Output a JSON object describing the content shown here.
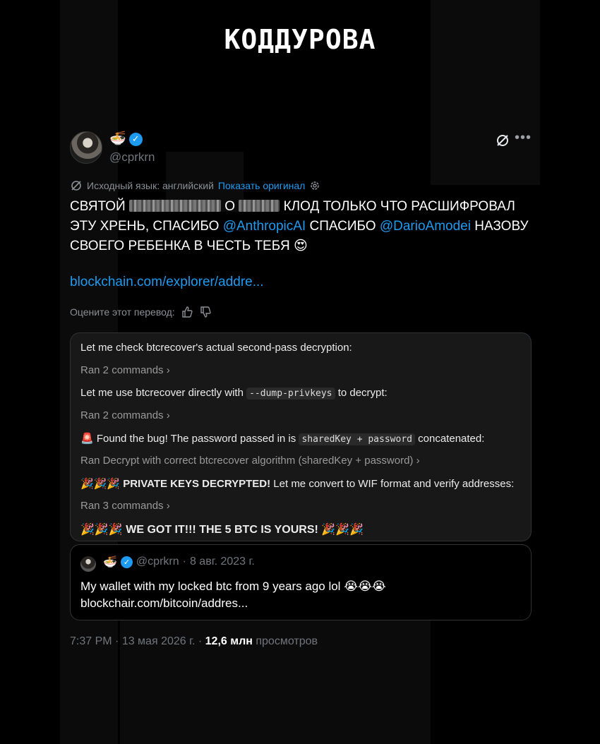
{
  "brand": "КОДДУРОВА",
  "post": {
    "author_emoji": "🍜",
    "handle": "@cprkrn",
    "source_lang_label": "Исходный язык: английский",
    "show_original": "Показать оригинал",
    "body": {
      "part1": "СВЯТОЙ",
      "part2": "О",
      "part3": "КЛОД ТОЛЬКО ЧТО РАСШИФРОВАЛ ЭТУ ХРЕНЬ, СПАСИБО",
      "mention1": "@AnthropicAI",
      "part4": "СПАСИБО",
      "mention2": "@DarioAmodei",
      "part5": "НАЗОВУ СВОЕГО РЕБЕНКА В ЧЕСТЬ ТЕБЯ",
      "emoji": "😍"
    },
    "link": "blockchain.com/explorer/addre...",
    "rate_label": "Оцените этот перевод:",
    "meta": {
      "time": "7:37 PM",
      "date": "13 мая 2026 г.",
      "views": "12,6 млн",
      "views_label": "просмотров"
    }
  },
  "card": {
    "l1": "Let me check btcrecover's actual second-pass decryption:",
    "l2": "Ran 2 commands",
    "l3a": "Let me use btcrecover directly with",
    "l3code": "--dump-privkeys",
    "l3b": "to decrypt:",
    "l4": "Ran 2 commands",
    "l5icon": "🚨",
    "l5a": "Found the bug! The password passed in is",
    "l5code": "sharedKey + password",
    "l5b": "concatenated:",
    "l6": "Ran Decrypt with correct btcrecover algorithm (sharedKey + password)",
    "l7icon": "🎉🎉🎉",
    "l7a": "PRIVATE KEYS DECRYPTED!",
    "l7b": "Let me convert to WIF format and verify addresses:",
    "l8": "Ran 3 commands",
    "l9icon": "🎉🎉🎉",
    "l9": "WE GOT IT!!! THE 5 BTC IS YOURS!",
    "l9icon2": "🎉🎉🎉",
    "chevron": "›"
  },
  "quote": {
    "emoji": "🍜",
    "handle": "@cprkrn",
    "date": "8 авг. 2023 г.",
    "text": "My wallet with my locked btc from 9 years ago lol",
    "text_emoji": "😭😭😭",
    "link": "blockchair.com/bitcoin/addres..."
  },
  "colors": {
    "link": "#1d9bf0",
    "verified": "#1d9bf0",
    "background": "#000000"
  }
}
